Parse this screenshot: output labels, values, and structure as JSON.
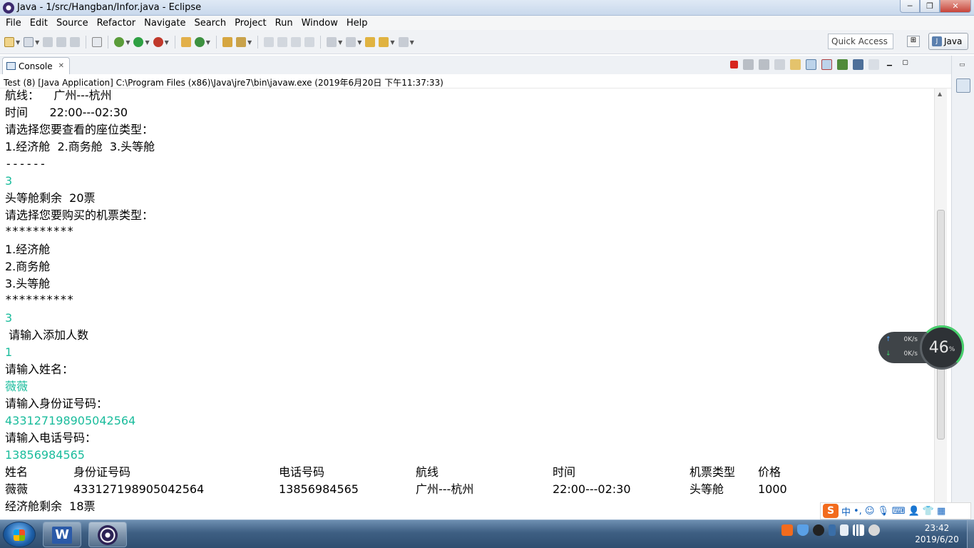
{
  "window": {
    "title": "Java - 1/src/Hangban/Infor.java - Eclipse",
    "controls": {
      "minimize": "─",
      "restore": "❐",
      "close": "✕"
    }
  },
  "menu": [
    "File",
    "Edit",
    "Source",
    "Refactor",
    "Navigate",
    "Search",
    "Project",
    "Run",
    "Window",
    "Help"
  ],
  "toolbar": {
    "quick_access_placeholder": "Quick Access",
    "perspective": "Java"
  },
  "console_view": {
    "tab_label": "Console",
    "close_glyph": "✕",
    "process_info": "Test (8) [Java Application] C:\\Program Files (x86)\\Java\\jre7\\bin\\javaw.exe (2019年6月20日 下午11:37:33)"
  },
  "console_lines": [
    {
      "text": "航线：    广州---杭州",
      "input": false
    },
    {
      "text": "时间      22:00---02:30",
      "input": false
    },
    {
      "text": "请选择您要查看的座位类型：",
      "input": false
    },
    {
      "text": "1.经济舱  2.商务舱  3.头等舱",
      "input": false
    },
    {
      "text": "------",
      "input": false
    },
    {
      "text": "3",
      "input": true
    },
    {
      "text": "头等舱剩余  20票",
      "input": false
    },
    {
      "text": "请选择您要购买的机票类型：",
      "input": false
    },
    {
      "text": "**********",
      "input": false
    },
    {
      "text": "1.经济舱",
      "input": false
    },
    {
      "text": "2.商务舱",
      "input": false
    },
    {
      "text": "3.头等舱",
      "input": false
    },
    {
      "text": "**********",
      "input": false
    },
    {
      "text": "3",
      "input": true
    },
    {
      "text": " 请输入添加人数",
      "input": false
    },
    {
      "text": "1",
      "input": true
    },
    {
      "text": "请输入姓名：",
      "input": false
    },
    {
      "text": "薇薇",
      "input": true
    },
    {
      "text": "请输入身份证号码：",
      "input": false
    },
    {
      "text": "433127198905042564",
      "input": true
    },
    {
      "text": "请输入电话号码：",
      "input": false
    },
    {
      "text": "13856984565",
      "input": true
    }
  ],
  "table": {
    "headers": [
      "姓名",
      "身份证号码",
      "电话号码",
      "航线",
      "时间",
      "机票类型",
      "价格"
    ],
    "row": [
      "薇薇",
      "433127198905042564",
      "13856984565",
      "广州---杭州",
      "22:00---02:30",
      "头等舱",
      "1000"
    ]
  },
  "footer_line": "经济舱剩余  18票",
  "network": {
    "up": "0K/s",
    "down": "0K/s",
    "cpu_value": "46",
    "cpu_unit": "%"
  },
  "ime": {
    "mode": "中",
    "punct": "•,"
  },
  "taskbar": {
    "time": "23:42",
    "date": "2019/6/20"
  }
}
